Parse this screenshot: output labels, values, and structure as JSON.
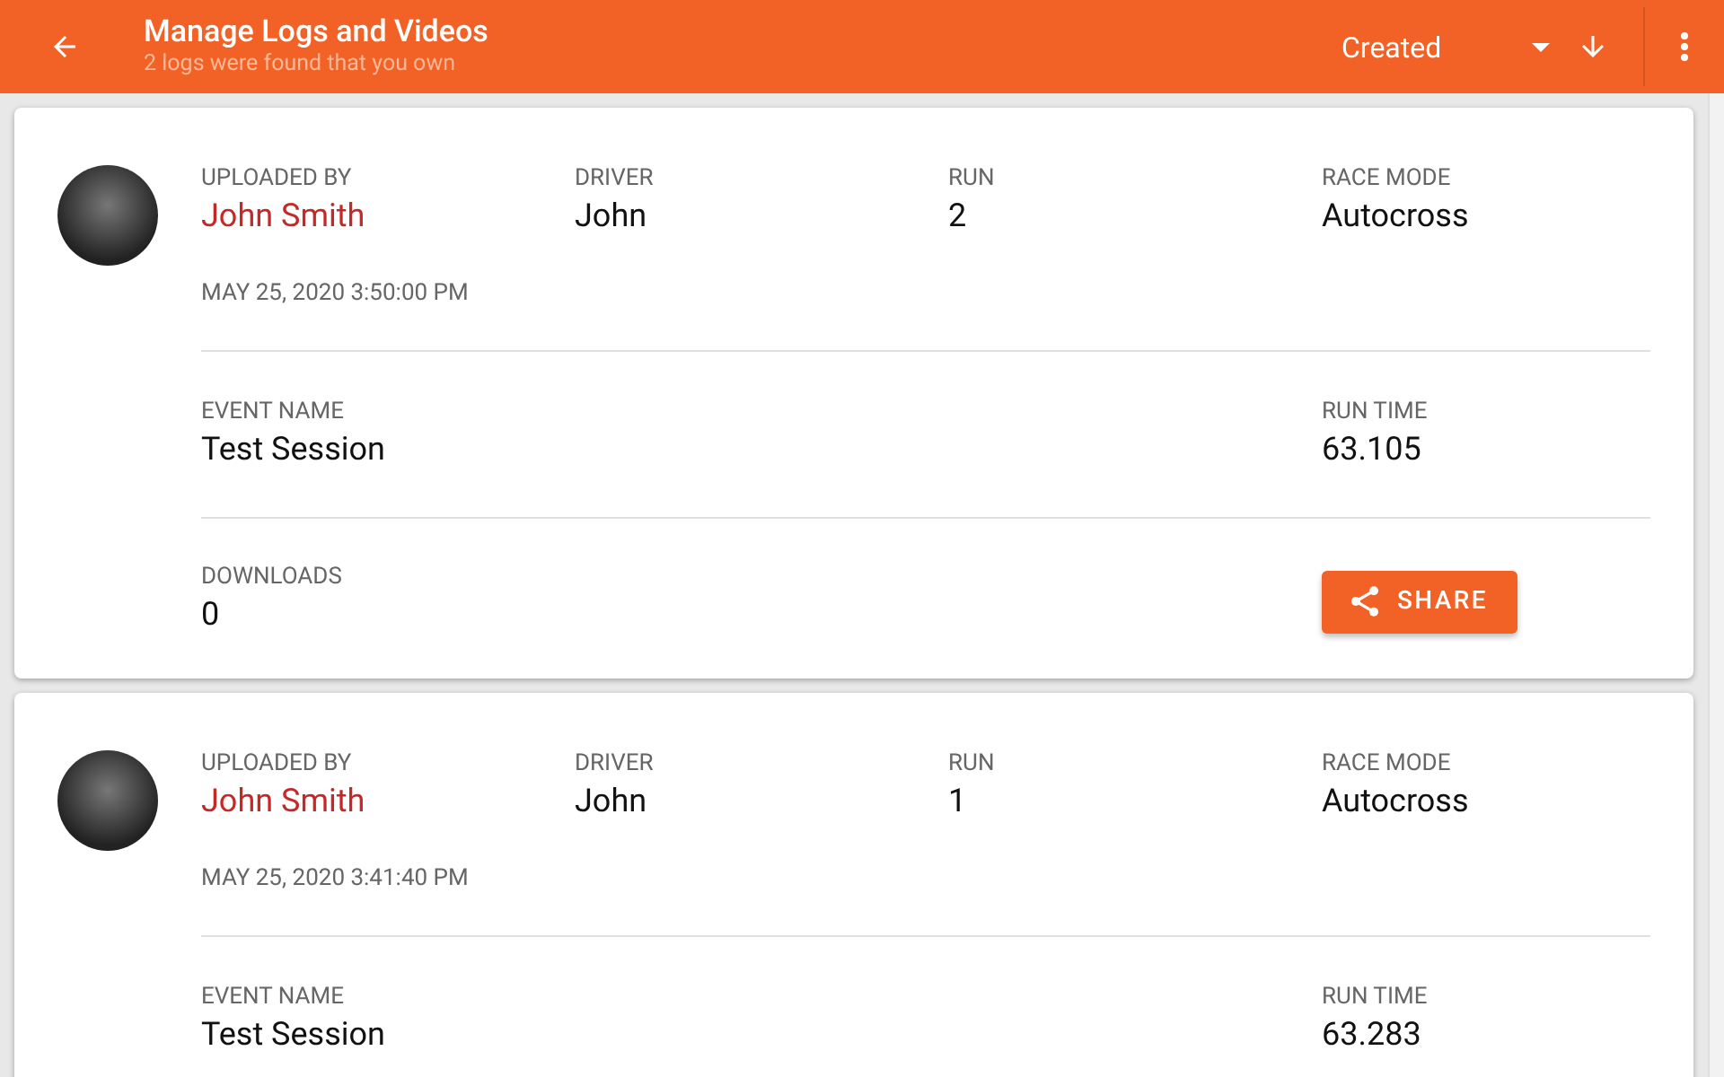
{
  "app_bar": {
    "title": "Manage Logs and Videos",
    "subtitle": "2 logs were found that you own",
    "sort": {
      "value": "Created"
    }
  },
  "logs": [
    {
      "uploaded_by": {
        "label": "UPLOADED BY",
        "value": "John Smith"
      },
      "driver": {
        "label": "DRIVER",
        "value": "John"
      },
      "run": {
        "label": "RUN",
        "value": "2"
      },
      "race_mode": {
        "label": "RACE MODE",
        "value": "Autocross"
      },
      "date": "MAY 25, 2020 3:50:00 PM",
      "event_name": {
        "label": "EVENT NAME",
        "value": "Test Session"
      },
      "run_time": {
        "label": "RUN TIME",
        "value": "63.105"
      },
      "downloads": {
        "label": "DOWNLOADS",
        "value": "0"
      },
      "share_button": "SHARE"
    },
    {
      "uploaded_by": {
        "label": "UPLOADED BY",
        "value": "John Smith"
      },
      "driver": {
        "label": "DRIVER",
        "value": "John"
      },
      "run": {
        "label": "RUN",
        "value": "1"
      },
      "race_mode": {
        "label": "RACE MODE",
        "value": "Autocross"
      },
      "date": "MAY 25, 2020 3:41:40 PM",
      "event_name": {
        "label": "EVENT NAME",
        "value": "Test Session"
      },
      "run_time": {
        "label": "RUN TIME",
        "value": "63.283"
      }
    }
  ]
}
